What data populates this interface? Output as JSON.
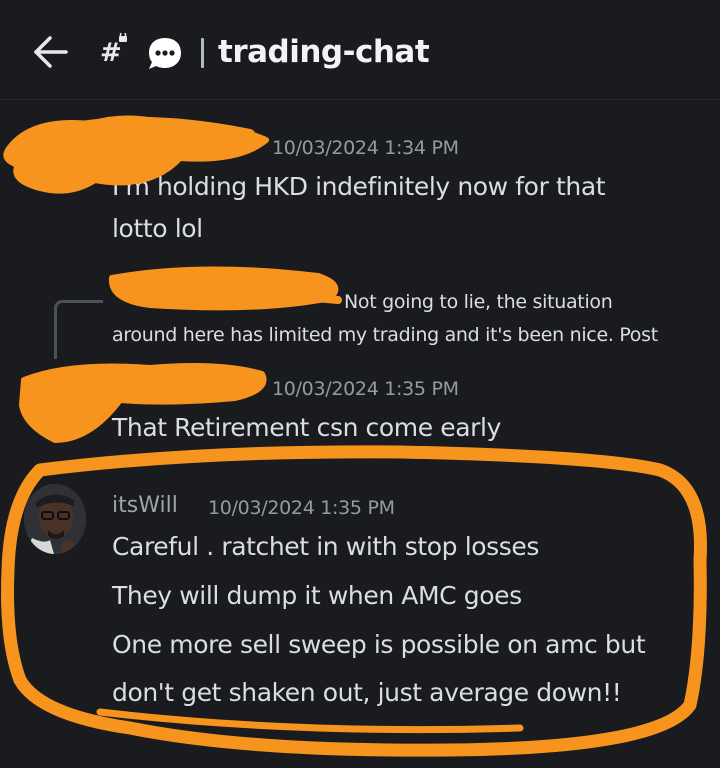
{
  "header": {
    "channel_name": "trading-chat",
    "icons": [
      "back-arrow-icon",
      "channel-hash-icon",
      "thread-icon"
    ]
  },
  "messages": [
    {
      "author": "",
      "timestamp": "10/03/2024 1:34 PM",
      "lines": [
        "I'm holding HKD indefinitely now for that",
        "lotto lol"
      ]
    },
    {
      "reply_preview": {
        "author": "",
        "lines": [
          "Not going to lie, the situation",
          "around here has limited my trading and it's been nice. Post"
        ]
      },
      "author": "",
      "timestamp": "10/03/2024 1:35 PM",
      "lines": [
        "That Retirement csn come early"
      ]
    },
    {
      "author": "itsWill",
      "timestamp": "10/03/2024 1:35 PM",
      "lines": [
        "Careful . ratchet in with stop losses",
        "They will dump it when AMC goes",
        "One more sell sweep is possible on amc but",
        "don't get shaken out, just average down!!"
      ]
    }
  ],
  "colors": {
    "background": "#1a1b1e",
    "text": "#dbdee1",
    "timestamp": "#949ba4",
    "scribble": "#f7941d"
  }
}
